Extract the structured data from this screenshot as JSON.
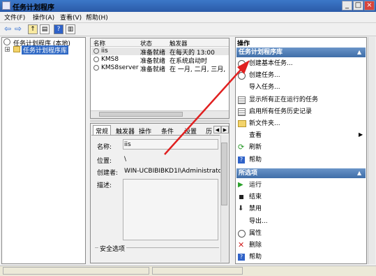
{
  "window": {
    "title": "任务计划程序",
    "min": "_",
    "max": "□",
    "close": "×"
  },
  "menu": [
    "文件(F)",
    "操作(A)",
    "查看(V)",
    "帮助(H)"
  ],
  "tree": {
    "root": "任务计划程序 (本地)",
    "child": "任务计划程序库"
  },
  "grid": {
    "columns": [
      "名称",
      "状态",
      "触发器"
    ],
    "rows": [
      {
        "name": "iis",
        "status": "准备就绪",
        "trigger": "在每天的 13:00"
      },
      {
        "name": "KMS8",
        "status": "准备就绪",
        "trigger": "在系统启动时"
      },
      {
        "name": "KMS8server",
        "status": "准备就绪",
        "trigger": "在 一月, 二月, 三月,"
      }
    ]
  },
  "tabs": [
    "常规",
    "触发器",
    "操作",
    "条件",
    "设置",
    "历"
  ],
  "detail": {
    "name_label": "名称:",
    "name_value": "iis",
    "location_label": "位置:",
    "location_value": "\\",
    "author_label": "创建者:",
    "author_value": "WIN-UCBIBIBKD1I\\Administrator",
    "desc_label": "描述:",
    "security_label": "安全选项"
  },
  "actions": {
    "header": "操作",
    "section1": "任务计划程序库",
    "items1": [
      {
        "label": "创建基本任务...",
        "icon": "clock-icon"
      },
      {
        "label": "创建任务...",
        "icon": "clock-icon"
      },
      {
        "label": "导入任务...",
        "icon": "none"
      },
      {
        "label": "显示所有正在运行的任务",
        "icon": "list-icon"
      },
      {
        "label": "启用所有任务历史记录",
        "icon": "list-icon"
      },
      {
        "label": "新文件夹...",
        "icon": "folder-icon"
      },
      {
        "label": "查看",
        "icon": "none"
      },
      {
        "label": "刷新",
        "icon": "refresh-icon"
      },
      {
        "label": "帮助",
        "icon": "help-icon"
      }
    ],
    "section2": "所选项",
    "items2": [
      {
        "label": "运行",
        "icon": "run-icon"
      },
      {
        "label": "结束",
        "icon": "stop-icon"
      },
      {
        "label": "禁用",
        "icon": "disable-icon"
      },
      {
        "label": "导出...",
        "icon": "none"
      },
      {
        "label": "属性",
        "icon": "clock-icon"
      },
      {
        "label": "删除",
        "icon": "delete-icon"
      },
      {
        "label": "帮助",
        "icon": "help-icon"
      }
    ]
  },
  "colors": {
    "accent": "#3f6ea8",
    "arrow": "#e02020",
    "selection": "#316ac5"
  }
}
